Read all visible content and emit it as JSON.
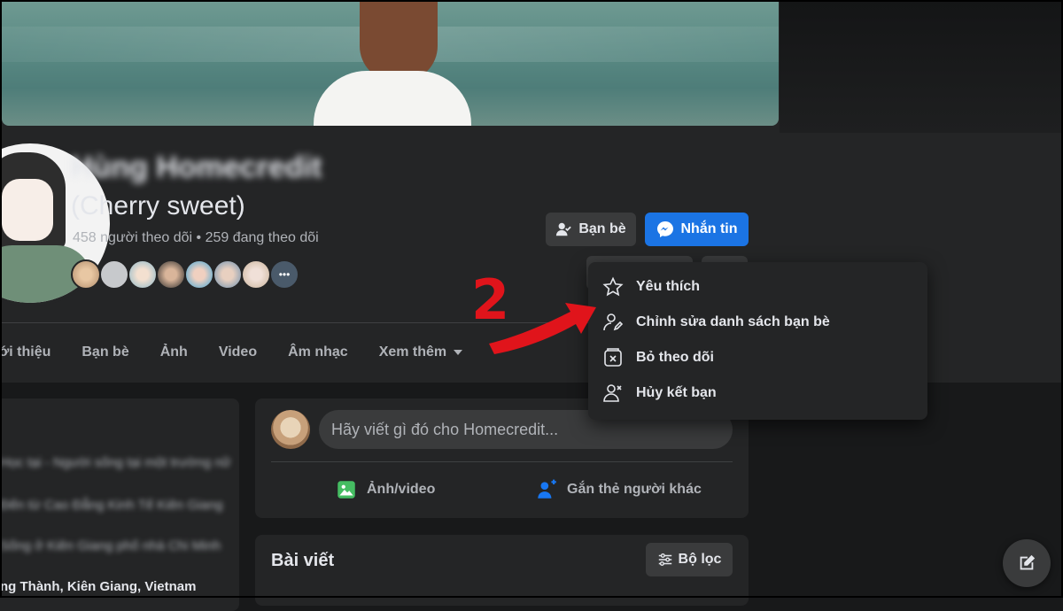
{
  "profile": {
    "name": "Hùng Homecredit",
    "alternate_name": "(Cherry sweet)",
    "follow_stats": "458 người theo dõi • 259 đang theo dõi"
  },
  "actions": {
    "friends_label": "Bạn bè",
    "message_label": "Nhắn tin"
  },
  "tabs": [
    {
      "label": "Giới thiệu"
    },
    {
      "label": "Bạn bè"
    },
    {
      "label": "Ảnh"
    },
    {
      "label": "Video"
    },
    {
      "label": "Âm nhạc"
    },
    {
      "label": "Xem thêm"
    }
  ],
  "friend_menu": {
    "items": [
      {
        "label": "Yêu thích",
        "icon": "star-icon"
      },
      {
        "label": "Chỉnh sửa danh sách bạn bè",
        "icon": "edit-friend-list-icon"
      },
      {
        "label": "Bỏ theo dõi",
        "icon": "unfollow-icon"
      },
      {
        "label": "Hủy kết bạn",
        "icon": "unfriend-icon"
      }
    ]
  },
  "annotation": {
    "step_number": "2",
    "color": "#e0141b"
  },
  "intro": {
    "rows": [
      "Học tại - Người sống tại một trường nữ",
      "Đến từ Cao Đẳng Kinh Tế Kiên Giang",
      "Sống ở Kiên Giang phố nhà Chi Minh",
      "Sống tại Hòn Đất Thành, Kiên Giang, Vietnam"
    ],
    "visible_row": "ng Thành, Kiên Giang, Vietnam"
  },
  "composer": {
    "placeholder": "Hãy viết gì đó cho Homecredit...",
    "photo_video_label": "Ảnh/video",
    "tag_people_label": "Gắn thẻ người khác"
  },
  "posts": {
    "title": "Bài viết",
    "filter_label": "Bộ lọc"
  },
  "colors": {
    "background": "#18191a",
    "surface": "#242526",
    "button": "#3a3b3c",
    "accent": "#1b74e4",
    "text": "#e4e6eb",
    "muted": "#b0b3b8"
  }
}
